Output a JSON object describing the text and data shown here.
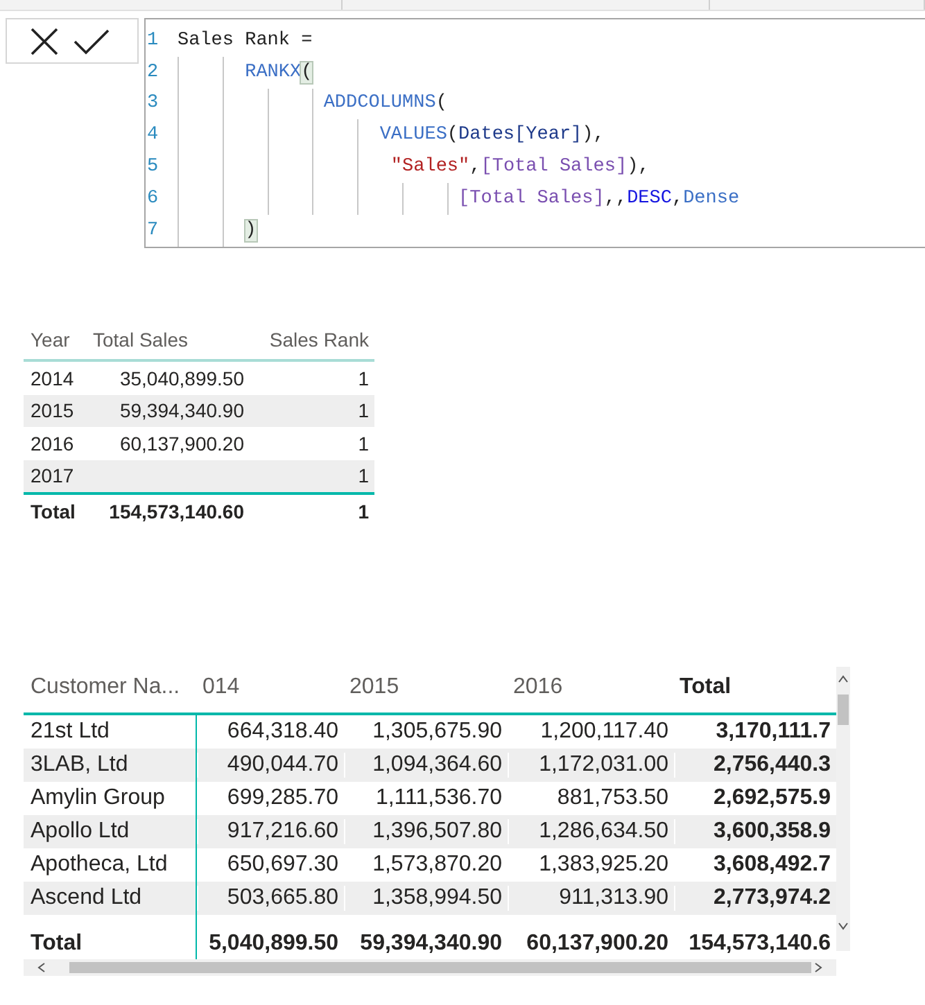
{
  "formula_bar": {
    "buttons": [
      {
        "kind": "cancel"
      },
      {
        "kind": "commit"
      }
    ],
    "lines": [
      {
        "number": "1",
        "tokens": [
          {
            "kind": "plain",
            "text": "Sales Rank ="
          }
        ]
      },
      {
        "number": "2",
        "tokens": [
          {
            "kind": "function",
            "text": "      RANKX"
          },
          {
            "kind": "match",
            "text": "("
          }
        ]
      },
      {
        "number": "3",
        "tokens": [
          {
            "kind": "function",
            "text": "             ADDCOLUMNS"
          },
          {
            "kind": "plain",
            "text": "("
          }
        ]
      },
      {
        "number": "4",
        "tokens": [
          {
            "kind": "function",
            "text": "                  VALUES"
          },
          {
            "kind": "plain",
            "text": "("
          },
          {
            "kind": "column",
            "text": "Dates[Year]"
          },
          {
            "kind": "plain",
            "text": "),"
          }
        ]
      },
      {
        "number": "5",
        "tokens": [
          {
            "kind": "string",
            "text": "                   \"Sales\""
          },
          {
            "kind": "plain",
            "text": ","
          },
          {
            "kind": "measure",
            "text": "[Total Sales]"
          },
          {
            "kind": "plain",
            "text": "),"
          }
        ]
      },
      {
        "number": "6",
        "tokens": [
          {
            "kind": "measure",
            "text": "                         [Total Sales]"
          },
          {
            "kind": "plain",
            "text": ",,"
          },
          {
            "kind": "keyword",
            "text": "DESC"
          },
          {
            "kind": "plain",
            "text": ","
          },
          {
            "kind": "function",
            "text": "Dense"
          }
        ]
      },
      {
        "number": "7",
        "tokens": [
          {
            "kind": "match",
            "text": "      )"
          }
        ]
      }
    ]
  },
  "rank_table": {
    "columns": [
      "Year",
      "Total Sales",
      "Sales Rank"
    ],
    "rows": [
      [
        "2014",
        "35,040,899.50",
        "1"
      ],
      [
        "2015",
        "59,394,340.90",
        "1"
      ],
      [
        "2016",
        "60,137,900.20",
        "1"
      ],
      [
        "2017",
        "",
        "1"
      ]
    ],
    "total": [
      "Total",
      "154,573,140.60",
      "1"
    ]
  },
  "matrix": {
    "columns": [
      "Customer Na...",
      "014",
      "2015",
      "2016",
      "Total"
    ],
    "rows": [
      [
        "21st Ltd",
        "664,318.40",
        "1,305,675.90",
        "1,200,117.40",
        "3,170,111.7"
      ],
      [
        "3LAB, Ltd",
        "490,044.70",
        "1,094,364.60",
        "1,172,031.00",
        "2,756,440.3"
      ],
      [
        "Amylin Group",
        "699,285.70",
        "1,111,536.70",
        "881,753.50",
        "2,692,575.9"
      ],
      [
        "Apollo Ltd",
        "917,216.60",
        "1,396,507.80",
        "1,286,634.50",
        "3,600,358.9"
      ],
      [
        "Apotheca, Ltd",
        "650,697.30",
        "1,573,870.20",
        "1,383,925.20",
        "3,608,492.7"
      ],
      [
        "Ascend Ltd",
        "503,665.80",
        "1,358,994.50",
        "911,313.90",
        "2,773,974.2"
      ]
    ],
    "total": [
      "Total",
      "5,040,899.50",
      "59,394,340.90",
      "60,137,900.20",
      "154,573,140.6"
    ]
  }
}
